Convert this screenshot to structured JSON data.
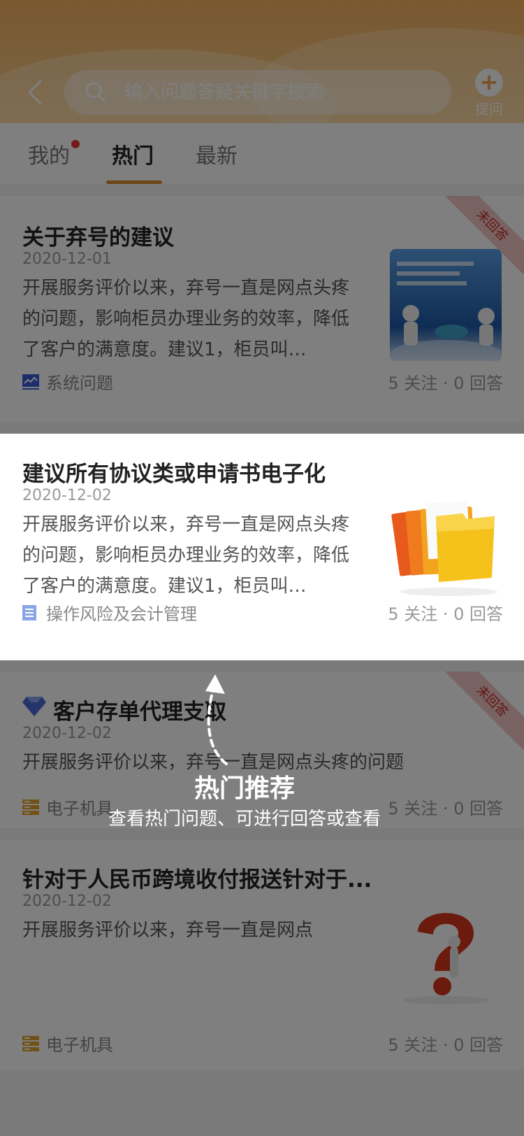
{
  "search": {
    "placeholder": "输入问题答疑关键字搜索"
  },
  "header": {
    "ask_label": "提问"
  },
  "tabs": [
    {
      "label": "我的"
    },
    {
      "label": "热门"
    },
    {
      "label": "最新"
    }
  ],
  "cards": [
    {
      "title": "关于弃号的建议",
      "date": "2020-12-01",
      "desc": "开展服务评价以来，弃号一直是网点头疼的问题，影响柜员办理业务的效率，降低了客户的满意度。建议1，柜员叫…",
      "category": "系统问题",
      "stats": "5 关注 · 0 回答",
      "badge": "未回答"
    },
    {
      "title": "建议所有协议类或申请书电子化",
      "date": "2020-12-02",
      "desc": "开展服务评价以来，弃号一直是网点头疼的问题，影响柜员办理业务的效率，降低了客户的满意度。建议1，柜员叫…",
      "category": "操作风险及会计管理",
      "stats": "5 关注 · 0 回答"
    },
    {
      "title": "客户存单代理支取",
      "date": "2020-12-02",
      "desc": "开展服务评价以来，弃号一直是网点头疼的问题",
      "category": "电子机具",
      "stats": "5 关注 · 0 回答",
      "badge": "未回答"
    },
    {
      "title": "针对于人民币跨境收付报送针对于...",
      "date": "2020-12-02",
      "desc": "开展服务评价以来，弃号一直是网点",
      "category": "电子机具",
      "stats": "5 关注 · 0 回答"
    }
  ],
  "guide": {
    "title": "热门推荐",
    "subtitle": "查看热门问题、可进行回答或查看"
  },
  "colors": {
    "accent": "#d98a2b",
    "header": "#f2b260",
    "badge_text": "#c62828",
    "dot": "#e53935"
  }
}
